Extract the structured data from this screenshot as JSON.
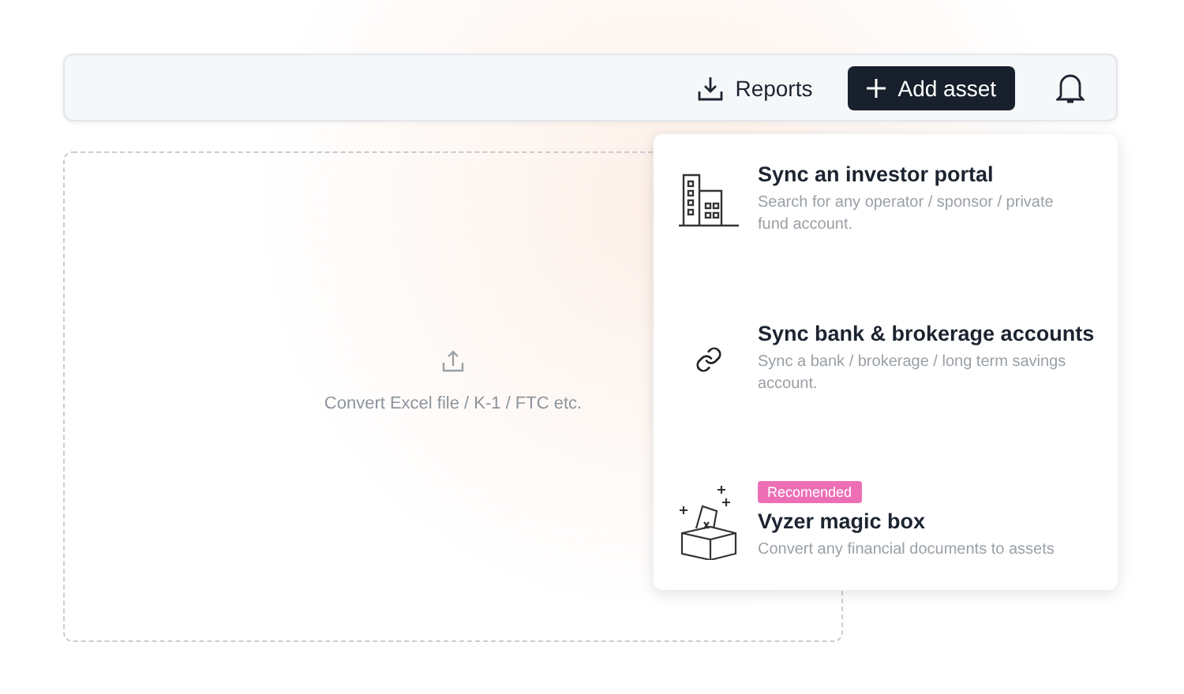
{
  "toolbar": {
    "reports_button": "Reports",
    "add_button": "Add asset"
  },
  "dropzone": {
    "text": "Convert Excel file / K-1 / FTC etc."
  },
  "menu": {
    "items": [
      {
        "kind": "building",
        "title": "Sync an investor portal",
        "description": "Search for any operator / sponsor / private fund account."
      },
      {
        "kind": "link",
        "title": "Sync bank & brokerage accounts",
        "description": "Sync a bank / brokerage / long term savings account."
      },
      {
        "kind": "magic",
        "badge": "Recomended",
        "title": "Vyzer magic box",
        "description": "Convert any financial documents to assets"
      }
    ]
  }
}
